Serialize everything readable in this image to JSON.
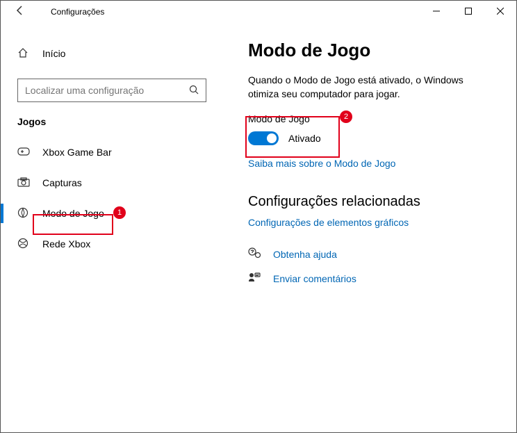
{
  "titlebar": {
    "title": "Configurações"
  },
  "sidebar": {
    "home": "Início",
    "search_placeholder": "Localizar uma configuração",
    "section": "Jogos",
    "items": [
      {
        "label": "Xbox Game Bar"
      },
      {
        "label": "Capturas"
      },
      {
        "label": "Modo de Jogo"
      },
      {
        "label": "Rede Xbox"
      }
    ]
  },
  "main": {
    "heading": "Modo de Jogo",
    "description": "Quando o Modo de Jogo está ativado, o Windows otimiza seu computador para jogar.",
    "toggle_title": "Modo de Jogo",
    "toggle_state": "Ativado",
    "learn_more": "Saiba mais sobre o Modo de Jogo",
    "related_heading": "Configurações relacionadas",
    "related_link": "Configurações de elementos gráficos",
    "help1": "Obtenha ajuda",
    "help2": "Enviar comentários"
  },
  "annotations": {
    "b1": "1",
    "b2": "2"
  }
}
